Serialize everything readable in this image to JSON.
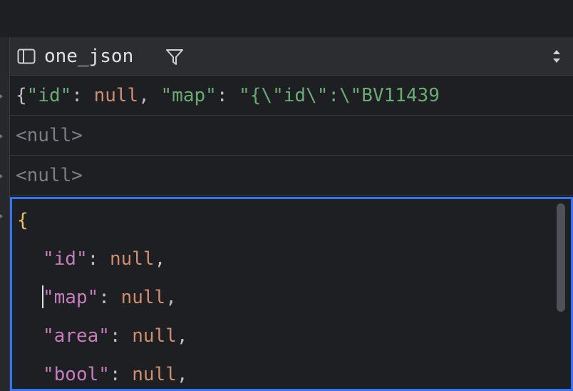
{
  "column": {
    "name": "one_json"
  },
  "rows": [
    {
      "preview_parts": [
        {
          "text": "{",
          "kind": "punc"
        },
        {
          "text": "\"id\"",
          "kind": "key"
        },
        {
          "text": ": ",
          "kind": "punc"
        },
        {
          "text": "null",
          "kind": "num"
        },
        {
          "text": ", ",
          "kind": "punc"
        },
        {
          "text": "\"map\"",
          "kind": "key"
        },
        {
          "text": ": ",
          "kind": "punc"
        },
        {
          "text": "\"{\\\"id\\\":\\\"BV11439",
          "kind": "str"
        }
      ]
    },
    {
      "value": "<null>"
    },
    {
      "value": "<null>"
    }
  ],
  "editor": {
    "open_brace": "{",
    "lines": [
      {
        "key": "\"id\"",
        "sep": ": ",
        "value": "null",
        "end": ","
      },
      {
        "key": "\"map\"",
        "sep": ": ",
        "value": "null",
        "end": ","
      },
      {
        "key": "\"area\"",
        "sep": ": ",
        "value": "null",
        "end": ","
      },
      {
        "key": "\"bool\"",
        "sep": ": ",
        "value": "null",
        "end": ","
      }
    ]
  },
  "icons": {
    "column": "column-panel-icon",
    "filter": "filter-icon",
    "sort": "sort-updown-icon"
  },
  "colors": {
    "accent": "#3574f0",
    "key": "#c77dbb",
    "null": "#cf8e6d",
    "string": "#6aab73",
    "brace": "#e8bf6a"
  }
}
